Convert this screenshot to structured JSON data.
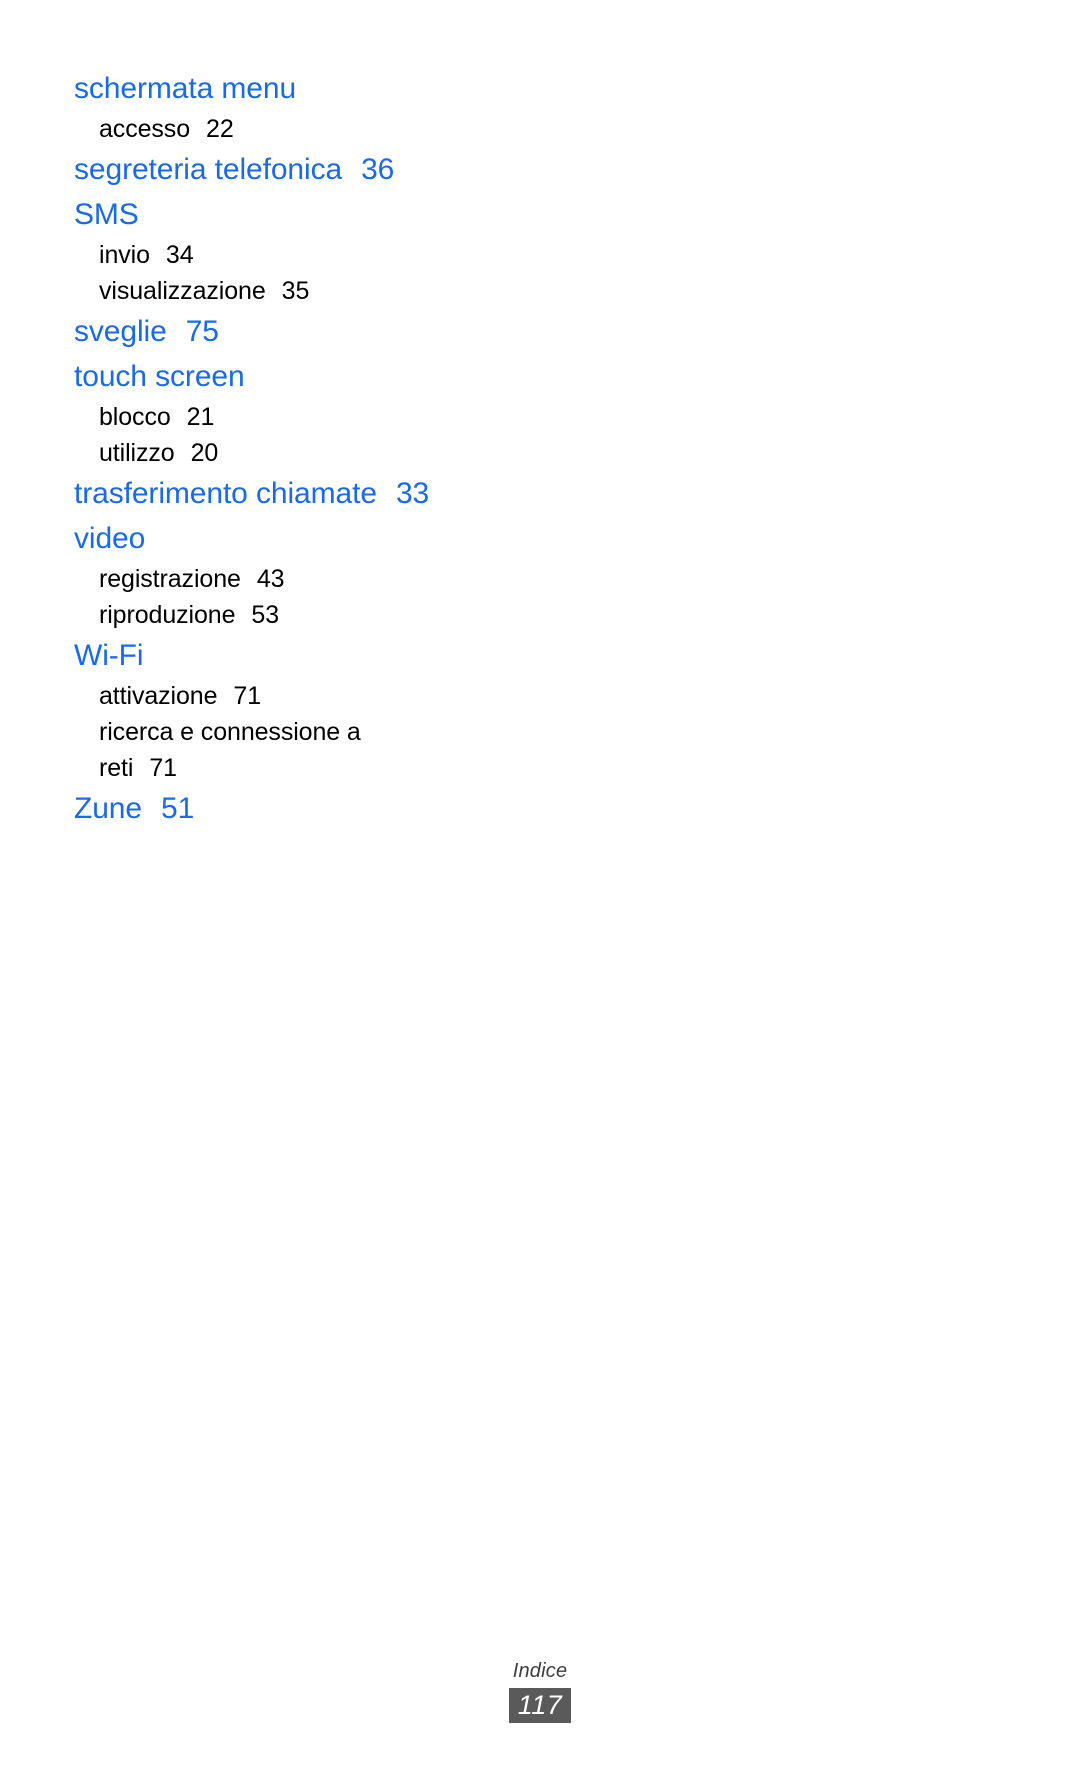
{
  "page": {
    "type": "index-page",
    "background_color": "#ffffff",
    "heading_color": "#1a6ae8",
    "entry_color": "#000000",
    "footer_badge_color": "#5a5a5a"
  },
  "index": {
    "groups": [
      {
        "heading": "schermata menu",
        "heading_page": "",
        "entries": [
          {
            "label": "accesso",
            "page": "22"
          }
        ]
      },
      {
        "heading": "segreteria telefonica",
        "heading_page": "36",
        "entries": []
      },
      {
        "heading": "SMS",
        "heading_page": "",
        "entries": [
          {
            "label": "invio",
            "page": "34"
          },
          {
            "label": "visualizzazione",
            "page": "35"
          }
        ]
      },
      {
        "heading": "sveglie",
        "heading_page": "75",
        "entries": []
      },
      {
        "heading": "touch screen",
        "heading_page": "",
        "entries": [
          {
            "label": "blocco",
            "page": "21"
          },
          {
            "label": "utilizzo",
            "page": "20"
          }
        ]
      },
      {
        "heading": "trasferimento chiamate",
        "heading_page": "33",
        "entries": []
      },
      {
        "heading": "video",
        "heading_page": "",
        "entries": [
          {
            "label": "registrazione",
            "page": "43"
          },
          {
            "label": "riproduzione",
            "page": "53"
          }
        ]
      },
      {
        "heading": "Wi-Fi",
        "heading_page": "",
        "entries": [
          {
            "label": "attivazione",
            "page": "71"
          },
          {
            "label": "ricerca e connessione a",
            "page": ""
          },
          {
            "label": "reti",
            "page": "71"
          }
        ]
      },
      {
        "heading": "Zune",
        "heading_page": "51",
        "entries": []
      }
    ]
  },
  "footer": {
    "label": "Indice",
    "page_number": "117"
  }
}
